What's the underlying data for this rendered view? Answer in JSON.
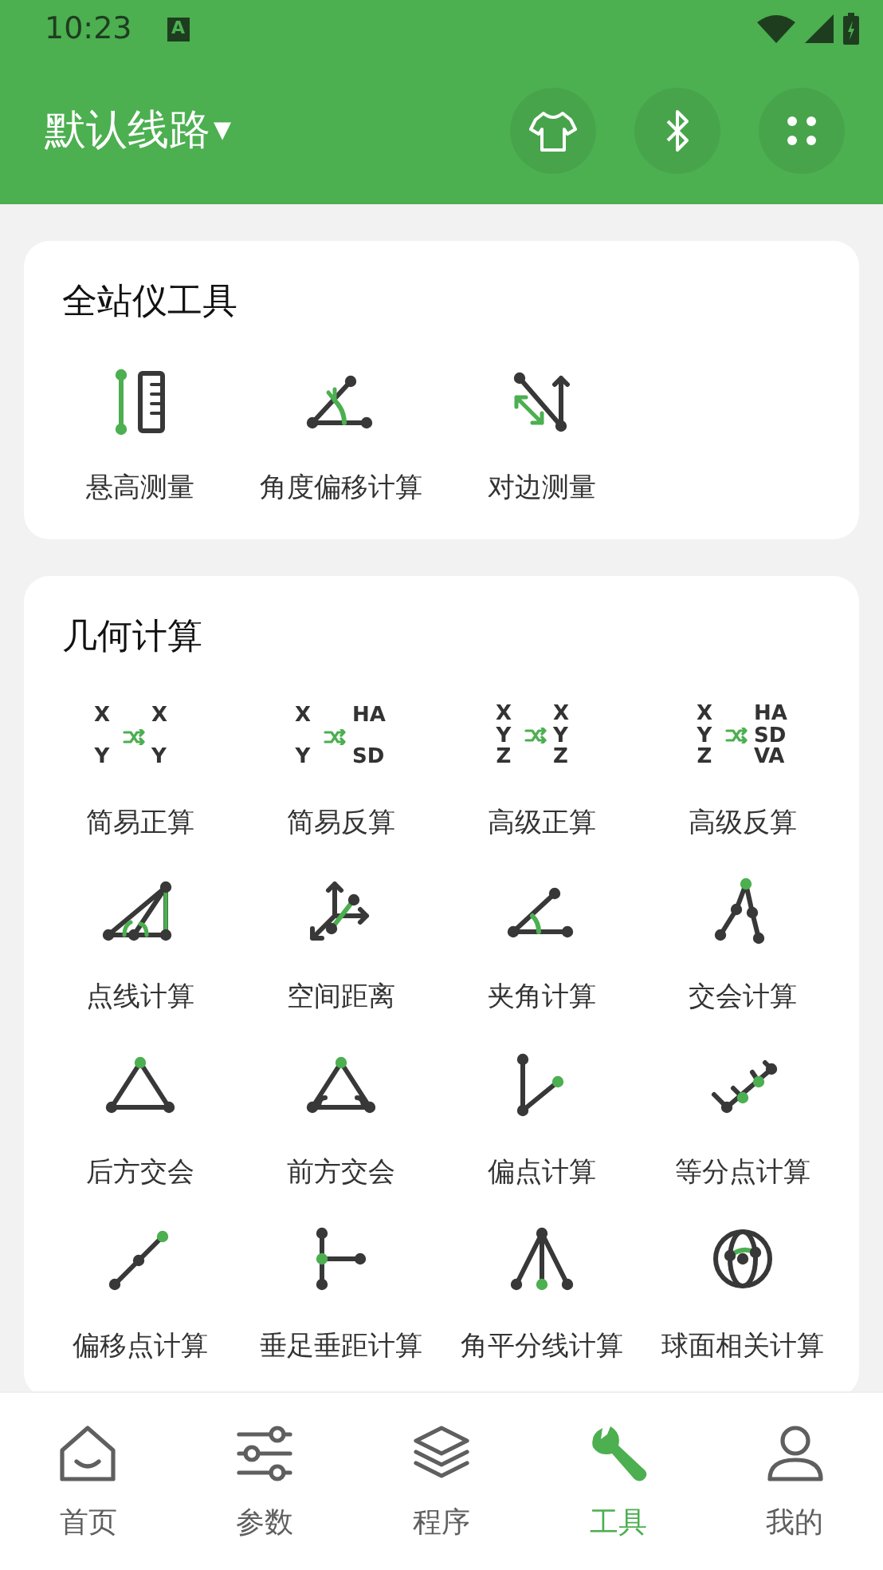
{
  "status_bar": {
    "time": "10:23",
    "notification_letter": "A"
  },
  "header": {
    "title": "默认线路",
    "dropdown_caret": "▾"
  },
  "sections": [
    {
      "title": "全站仪工具",
      "tools": [
        {
          "kind": "glyph",
          "label": "悬高测量"
        },
        {
          "kind": "glyph",
          "label": "角度偏移计算"
        },
        {
          "kind": "glyph",
          "label": "对边测量"
        }
      ]
    },
    {
      "title": "几何计算",
      "tools": [
        {
          "kind": "coords",
          "label": "简易正算",
          "left": [
            "X",
            "Y"
          ],
          "right": [
            "X",
            "Y"
          ]
        },
        {
          "kind": "coords",
          "label": "简易反算",
          "left": [
            "X",
            "Y"
          ],
          "right": [
            "HA",
            "SD"
          ]
        },
        {
          "kind": "coords",
          "label": "高级正算",
          "left": [
            "X",
            "Y",
            "Z"
          ],
          "right": [
            "X",
            "Y",
            "Z"
          ]
        },
        {
          "kind": "coords",
          "label": "高级反算",
          "left": [
            "X",
            "Y",
            "Z"
          ],
          "right": [
            "HA",
            "SD",
            "VA"
          ]
        },
        {
          "kind": "glyph",
          "label": "点线计算"
        },
        {
          "kind": "glyph",
          "label": "空间距离"
        },
        {
          "kind": "glyph",
          "label": "夹角计算"
        },
        {
          "kind": "glyph",
          "label": "交会计算"
        },
        {
          "kind": "glyph",
          "label": "后方交会"
        },
        {
          "kind": "glyph",
          "label": "前方交会"
        },
        {
          "kind": "glyph",
          "label": "偏点计算"
        },
        {
          "kind": "glyph",
          "label": "等分点计算"
        },
        {
          "kind": "glyph",
          "label": "偏移点计算"
        },
        {
          "kind": "glyph",
          "label": "垂足垂距计算"
        },
        {
          "kind": "glyph",
          "label": "角平分线计算"
        },
        {
          "kind": "glyph",
          "label": "球面相关计算"
        }
      ]
    }
  ],
  "bottom_nav": [
    {
      "label": "首页",
      "selected": false
    },
    {
      "label": "参数",
      "selected": false
    },
    {
      "label": "程序",
      "selected": false
    },
    {
      "label": "工具",
      "selected": true
    },
    {
      "label": "我的",
      "selected": false
    }
  ]
}
